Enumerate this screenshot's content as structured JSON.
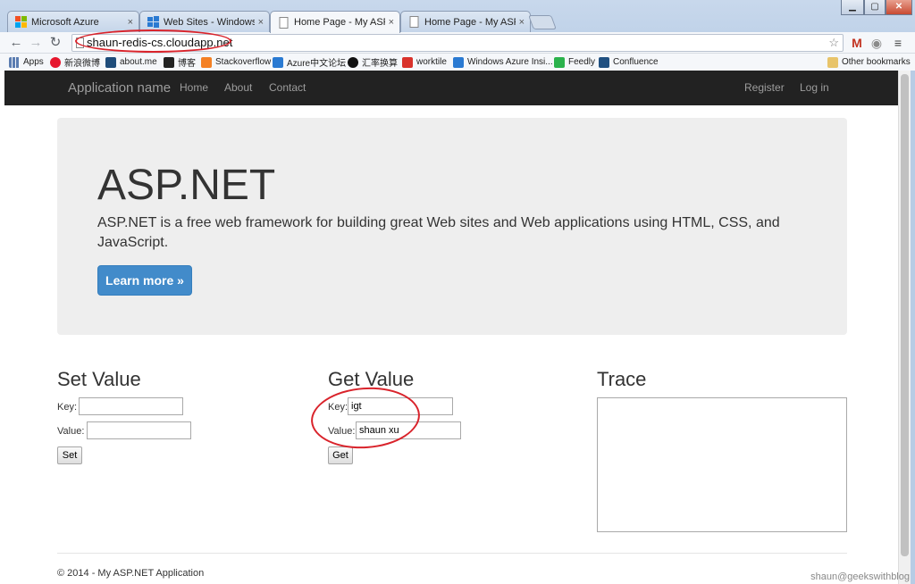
{
  "browser": {
    "tabs": [
      {
        "title": "Microsoft Azure",
        "active": false,
        "icon": "ms-logo-icon"
      },
      {
        "title": "Web Sites - Windows Azu",
        "active": false,
        "icon": "windows-logo-icon"
      },
      {
        "title": "Home Page - My ASP.NET",
        "active": true,
        "icon": "page-icon"
      },
      {
        "title": "Home Page - My ASP.NE",
        "active": false,
        "icon": "page-icon"
      }
    ],
    "tab_close_glyph": "×",
    "url": "shaun-redis-cs.cloudapp.net",
    "bookmarks": [
      "Apps",
      "新浪微博",
      "about.me",
      "博客",
      "Stackoverflow",
      "Azure中文论坛",
      "汇率换算",
      "worktile",
      "Windows Azure Insi...",
      "Feedly",
      "Confluence"
    ],
    "other_bookmarks": "Other bookmarks",
    "colors": {
      "annotation": "#d9232b",
      "accent": "#428bca",
      "navbar": "#222222"
    }
  },
  "nav": {
    "brand": "Application name",
    "links": [
      "Home",
      "About",
      "Contact"
    ],
    "right_links": [
      "Register",
      "Log in"
    ]
  },
  "jumbotron": {
    "title": "ASP.NET",
    "lead": "ASP.NET is a free web framework for building great Web sites and Web applications using HTML, CSS, and JavaScript.",
    "button": "Learn more »"
  },
  "set_value": {
    "title": "Set Value",
    "key_label": "Key:",
    "key_value": "",
    "value_label": "Value:",
    "value_value": "",
    "button": "Set"
  },
  "get_value": {
    "title": "Get Value",
    "key_label": "Key:",
    "key_value": "igt",
    "value_label": "Value:",
    "value_value": "shaun xu",
    "button": "Get"
  },
  "trace": {
    "title": "Trace",
    "content": ""
  },
  "footer": "© 2014 - My ASP.NET Application",
  "watermark": "shaun@geekswithblog"
}
